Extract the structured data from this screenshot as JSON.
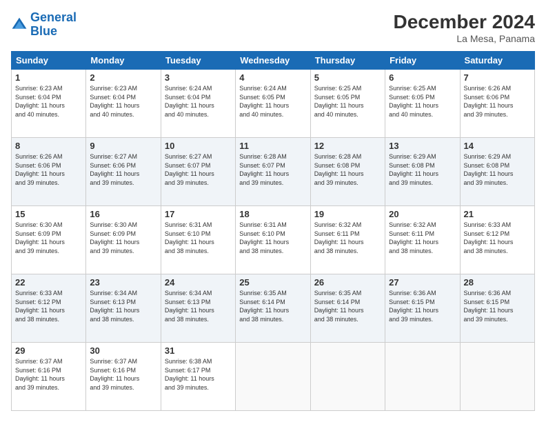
{
  "header": {
    "logo_line1": "General",
    "logo_line2": "Blue",
    "month_year": "December 2024",
    "location": "La Mesa, Panama"
  },
  "weekdays": [
    "Sunday",
    "Monday",
    "Tuesday",
    "Wednesday",
    "Thursday",
    "Friday",
    "Saturday"
  ],
  "weeks": [
    [
      {
        "day": "1",
        "text": "Sunrise: 6:23 AM\nSunset: 6:04 PM\nDaylight: 11 hours\nand 40 minutes."
      },
      {
        "day": "2",
        "text": "Sunrise: 6:23 AM\nSunset: 6:04 PM\nDaylight: 11 hours\nand 40 minutes."
      },
      {
        "day": "3",
        "text": "Sunrise: 6:24 AM\nSunset: 6:04 PM\nDaylight: 11 hours\nand 40 minutes."
      },
      {
        "day": "4",
        "text": "Sunrise: 6:24 AM\nSunset: 6:05 PM\nDaylight: 11 hours\nand 40 minutes."
      },
      {
        "day": "5",
        "text": "Sunrise: 6:25 AM\nSunset: 6:05 PM\nDaylight: 11 hours\nand 40 minutes."
      },
      {
        "day": "6",
        "text": "Sunrise: 6:25 AM\nSunset: 6:05 PM\nDaylight: 11 hours\nand 40 minutes."
      },
      {
        "day": "7",
        "text": "Sunrise: 6:26 AM\nSunset: 6:06 PM\nDaylight: 11 hours\nand 39 minutes."
      }
    ],
    [
      {
        "day": "8",
        "text": "Sunrise: 6:26 AM\nSunset: 6:06 PM\nDaylight: 11 hours\nand 39 minutes."
      },
      {
        "day": "9",
        "text": "Sunrise: 6:27 AM\nSunset: 6:06 PM\nDaylight: 11 hours\nand 39 minutes."
      },
      {
        "day": "10",
        "text": "Sunrise: 6:27 AM\nSunset: 6:07 PM\nDaylight: 11 hours\nand 39 minutes."
      },
      {
        "day": "11",
        "text": "Sunrise: 6:28 AM\nSunset: 6:07 PM\nDaylight: 11 hours\nand 39 minutes."
      },
      {
        "day": "12",
        "text": "Sunrise: 6:28 AM\nSunset: 6:08 PM\nDaylight: 11 hours\nand 39 minutes."
      },
      {
        "day": "13",
        "text": "Sunrise: 6:29 AM\nSunset: 6:08 PM\nDaylight: 11 hours\nand 39 minutes."
      },
      {
        "day": "14",
        "text": "Sunrise: 6:29 AM\nSunset: 6:08 PM\nDaylight: 11 hours\nand 39 minutes."
      }
    ],
    [
      {
        "day": "15",
        "text": "Sunrise: 6:30 AM\nSunset: 6:09 PM\nDaylight: 11 hours\nand 39 minutes."
      },
      {
        "day": "16",
        "text": "Sunrise: 6:30 AM\nSunset: 6:09 PM\nDaylight: 11 hours\nand 39 minutes."
      },
      {
        "day": "17",
        "text": "Sunrise: 6:31 AM\nSunset: 6:10 PM\nDaylight: 11 hours\nand 38 minutes."
      },
      {
        "day": "18",
        "text": "Sunrise: 6:31 AM\nSunset: 6:10 PM\nDaylight: 11 hours\nand 38 minutes."
      },
      {
        "day": "19",
        "text": "Sunrise: 6:32 AM\nSunset: 6:11 PM\nDaylight: 11 hours\nand 38 minutes."
      },
      {
        "day": "20",
        "text": "Sunrise: 6:32 AM\nSunset: 6:11 PM\nDaylight: 11 hours\nand 38 minutes."
      },
      {
        "day": "21",
        "text": "Sunrise: 6:33 AM\nSunset: 6:12 PM\nDaylight: 11 hours\nand 38 minutes."
      }
    ],
    [
      {
        "day": "22",
        "text": "Sunrise: 6:33 AM\nSunset: 6:12 PM\nDaylight: 11 hours\nand 38 minutes."
      },
      {
        "day": "23",
        "text": "Sunrise: 6:34 AM\nSunset: 6:13 PM\nDaylight: 11 hours\nand 38 minutes."
      },
      {
        "day": "24",
        "text": "Sunrise: 6:34 AM\nSunset: 6:13 PM\nDaylight: 11 hours\nand 38 minutes."
      },
      {
        "day": "25",
        "text": "Sunrise: 6:35 AM\nSunset: 6:14 PM\nDaylight: 11 hours\nand 38 minutes."
      },
      {
        "day": "26",
        "text": "Sunrise: 6:35 AM\nSunset: 6:14 PM\nDaylight: 11 hours\nand 38 minutes."
      },
      {
        "day": "27",
        "text": "Sunrise: 6:36 AM\nSunset: 6:15 PM\nDaylight: 11 hours\nand 39 minutes."
      },
      {
        "day": "28",
        "text": "Sunrise: 6:36 AM\nSunset: 6:15 PM\nDaylight: 11 hours\nand 39 minutes."
      }
    ],
    [
      {
        "day": "29",
        "text": "Sunrise: 6:37 AM\nSunset: 6:16 PM\nDaylight: 11 hours\nand 39 minutes."
      },
      {
        "day": "30",
        "text": "Sunrise: 6:37 AM\nSunset: 6:16 PM\nDaylight: 11 hours\nand 39 minutes."
      },
      {
        "day": "31",
        "text": "Sunrise: 6:38 AM\nSunset: 6:17 PM\nDaylight: 11 hours\nand 39 minutes."
      },
      {
        "day": "",
        "text": ""
      },
      {
        "day": "",
        "text": ""
      },
      {
        "day": "",
        "text": ""
      },
      {
        "day": "",
        "text": ""
      }
    ]
  ]
}
